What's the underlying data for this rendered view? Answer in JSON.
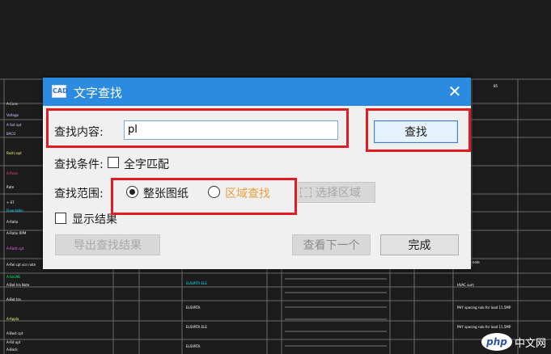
{
  "dialog": {
    "title": "文字查找",
    "app_icon_text": "CAD",
    "close_symbol": "✕",
    "search_content_label": "查找内容:",
    "search_value": "pl",
    "find_button": "查找",
    "search_condition_label": "查找条件:",
    "match_whole_word_label": "全字匹配",
    "match_whole_word_checked": false,
    "search_range_label": "查找范围:",
    "range_whole_drawing_label": "整张图纸",
    "range_whole_drawing_selected": true,
    "range_area_label": "区域查找",
    "range_area_selected": false,
    "select_area_label": "选择区域",
    "show_results_label": "显示结果",
    "show_results_checked": false,
    "export_button": "导出查找结果",
    "find_next_button": "查看下一个",
    "done_button": "完成"
  },
  "background": {
    "header_right_text": "85",
    "left_column_labels": [
      {
        "text": "A-Cons",
        "color": "#e0e0ff"
      },
      {
        "text": "Voltage",
        "color": "#d0d0ff"
      },
      {
        "text": "A-Sot opt",
        "color": "#d0d0ff"
      },
      {
        "text": "BACO",
        "color": "#d0d0ff"
      },
      {
        "text": "Rezhi opt",
        "color": "#ffff66"
      },
      {
        "text": "A-Rcon",
        "color": "#ff4d7a"
      },
      {
        "text": "Rate",
        "color": "#ffffff"
      },
      {
        "text": "+ 67",
        "color": "#ffffff"
      },
      {
        "text": "Flow-table",
        "color": "#00e5ff"
      },
      {
        "text": "A-Ratio",
        "color": "#ffffff"
      },
      {
        "text": "A-Ratio RPM",
        "color": "#ffffff"
      },
      {
        "text": "A-Rads cpt",
        "color": "#ff66ff"
      },
      {
        "text": "A-Rel cpt scn note",
        "color": "#ffffff"
      },
      {
        "text": "A-SecAB",
        "color": "#00ff66"
      },
      {
        "text": "A-Bot tra Note",
        "color": "#ffffff"
      },
      {
        "text": "A-Bot tra",
        "color": "#ffffff"
      },
      {
        "text": "A-Appla",
        "color": "#ffff66"
      },
      {
        "text": "A-Bost cpt",
        "color": "#ffffff"
      },
      {
        "text": "A-Rd opt",
        "color": "#ffffff"
      },
      {
        "text": "A-Back",
        "color": "#ffffff"
      }
    ],
    "right_labels": [
      {
        "text": "HVACrail-note",
        "color": "#ffffff"
      },
      {
        "text": "HVAC sum",
        "color": "#ffffff"
      },
      {
        "text": "PHY spacing rule for load 11.5MP",
        "color": "#ffffff"
      },
      {
        "text": "PHY spacing rule for load 11.5MP",
        "color": "#ffffff"
      }
    ],
    "center_labels": [
      {
        "text": "ELSVRTA ELE",
        "color": "#00e5ff"
      },
      {
        "text": "ELSVRTA",
        "color": "#ffffff"
      },
      {
        "text": "ELSVRTA ELE",
        "color": "#ffffff"
      },
      {
        "text": "ELSVRTA",
        "color": "#ffffff"
      }
    ]
  },
  "watermark": {
    "logo_text": "php",
    "site_text": "中文网"
  },
  "colors": {
    "titlebar": "#2a8be0",
    "highlight": "#e01b24",
    "area_label": "#e8a040",
    "cad_background": "#1c1c1c"
  }
}
